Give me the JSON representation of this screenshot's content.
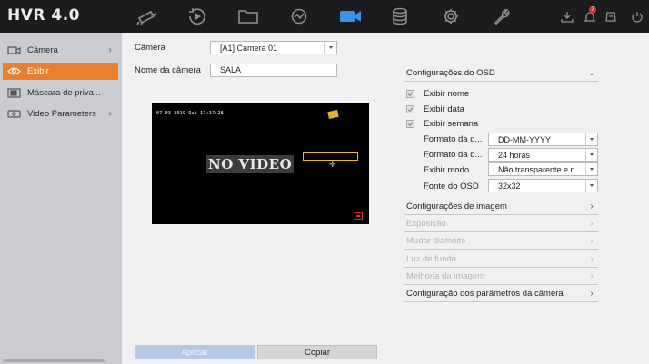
{
  "header": {
    "logo": "HVR 4.0",
    "nav": [
      "camera-icon",
      "playback-icon",
      "folder-icon",
      "search-analysis-icon",
      "camera-management-icon",
      "storage-icon",
      "settings-icon",
      "maintenance-icon"
    ],
    "active_nav": "camera-management-icon",
    "alarm_count": "7"
  },
  "sidebar": {
    "items": [
      {
        "label": "Câmera",
        "icon": "camera-icon",
        "has_chevron": true
      },
      {
        "label": "Exibir",
        "icon": "eye-icon",
        "active": true,
        "has_chevron": false
      },
      {
        "label": "Máscara de priva...",
        "icon": "privacy-mask-icon",
        "has_chevron": false
      },
      {
        "label": "Video Parameters",
        "icon": "video-icon",
        "has_chevron": true
      }
    ]
  },
  "form": {
    "camera_label": "Câmera",
    "camera_value": "[A1] Camera 01",
    "camera_name_label": "Nome da câmera",
    "camera_name_value": "SALA"
  },
  "preview": {
    "timestamp": "07-03-2019 Qui 17:17:28",
    "no_video": "NO VIDEO"
  },
  "osd": {
    "title": "Configurações do OSD",
    "checks": [
      {
        "label": "Exibir nome",
        "checked": true
      },
      {
        "label": "Exibir data",
        "checked": true
      },
      {
        "label": "Exibir semana",
        "checked": true
      }
    ],
    "fields": [
      {
        "label": "Formato da d...",
        "value": "DD-MM-YYYY"
      },
      {
        "label": "Formato da d...",
        "value": "24 horas"
      },
      {
        "label": "Exibir modo",
        "value": "Não transparente e n"
      },
      {
        "label": "Fonte do OSD",
        "value": "32x32"
      }
    ]
  },
  "sections": [
    {
      "label": "Configurações de imagem",
      "enabled": true
    },
    {
      "label": "Exposição",
      "enabled": false
    },
    {
      "label": "Mudar dia/noite",
      "enabled": false
    },
    {
      "label": "Luz de fundo",
      "enabled": false
    },
    {
      "label": "Melhoria da imagem",
      "enabled": false
    },
    {
      "label": "Configuração dos parâmetros da câmera",
      "enabled": true
    }
  ],
  "buttons": {
    "apply": "Aplicar",
    "copy": "Copiar"
  },
  "colors": {
    "topbar": "#1c1c1e",
    "accent": "#e9802f",
    "active_nav": "#3d8fe8",
    "sidebar": "#cbccd0"
  }
}
